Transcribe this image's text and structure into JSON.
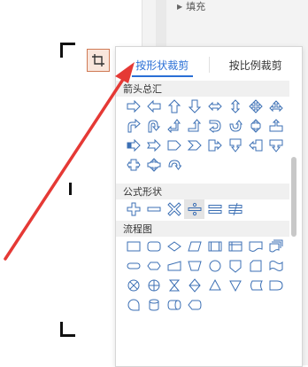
{
  "right_panel": {
    "fill_label": "填充"
  },
  "dropdown": {
    "tabs": [
      {
        "label": "按形状裁剪",
        "active": true
      },
      {
        "label": "按比例裁剪",
        "active": false
      }
    ],
    "sections": [
      {
        "title": "箭头总汇"
      },
      {
        "title": "公式形状"
      },
      {
        "title": "流程图"
      }
    ]
  },
  "colors": {
    "accent": "#2a6fd6",
    "shape_stroke": "#3b6fb4",
    "annotation_arrow": "#e53935"
  }
}
